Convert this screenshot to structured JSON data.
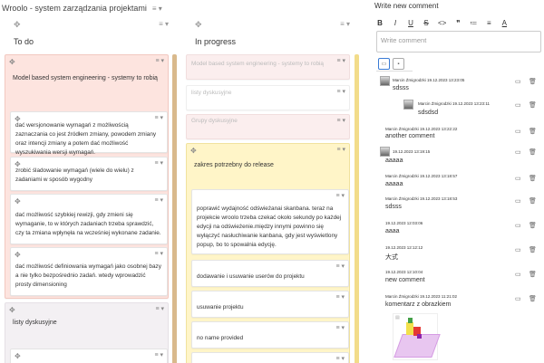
{
  "board": {
    "title": "Wroolo - system zarządzania projektami",
    "title_menu": "≡ ▾",
    "columns": [
      {
        "title": "To do",
        "cards": [
          {
            "text": "Model based system engineering - systemy to robią",
            "style": "pink"
          },
          {
            "text": "dać wersjonowanie wymagań z możliwością zaznaczania co jest źródłem zmiany, powodem zmiany oraz intencji zmiany a potem dać możliwość wyszukiwania wersji wymagań.",
            "style": "inner"
          },
          {
            "text": "zrobić śladowanie wymagań (wiele do wielu) z zadaniami w sposób wygodny",
            "style": "inner"
          },
          {
            "text": "dać możliwość szybkiej rewizji, gdy zmieni się wymaganie, to w których zadaniach trzeba sprawdzić, czy ta zmiana wpłynęła na wcześniej wykonane zadanie.",
            "style": "inner"
          },
          {
            "text": "dać możliwość definiowania wymagań jako osobnej bazy a nie tylko bezpośrednio zadań. wtedy wprowadzić prosty dimensioning",
            "style": "inner"
          },
          {
            "text": "listy dyskusyjne",
            "style": "grey"
          }
        ]
      },
      {
        "title": "In progress",
        "cards": [
          {
            "text": "Model based system engineering - systemy to robią",
            "style": "pinklight"
          },
          {
            "text": "listy dyskusyjne",
            "style": "ghost"
          },
          {
            "text": "Grupy dyskusyjne",
            "style": "pinklight"
          },
          {
            "text": "zakres potrzebny do release",
            "style": "yellow"
          },
          {
            "text": "poprawić wydajność odświeżanai skanbana. teraz na projekcie wroolo trzeba czekać około sekundy po każdej edycji na odświeżenie.między innymi powinno się wyłączyć nasłuchiwanie kanbana, gdy jest wyświetlony popup, bo to spowalnia edycję.",
            "style": "inner"
          },
          {
            "text": "dodawanie i usuwanie userów do projektu",
            "style": "inner"
          },
          {
            "text": "usuwanie projektu",
            "style": "inner"
          },
          {
            "text": "no name provided",
            "style": "inner"
          }
        ]
      }
    ]
  },
  "panel": {
    "title": "Write new comment",
    "toolbar": [
      "B",
      "I",
      "U",
      "S",
      "<>",
      "❞",
      "≔",
      "≡",
      "A"
    ],
    "placeholder": "Write comment",
    "comments": [
      {
        "author": "Marcin Żmigrodzki",
        "date": "19.12.2023 13:23:05",
        "text": "sdsss",
        "avatar": true,
        "indent": 0
      },
      {
        "author": "Marcin Żmigrodzki",
        "date": "19.12.2023 13:23:11",
        "text": "sdsdsd",
        "avatar": true,
        "indent": 1
      },
      {
        "author": "Marcin Żmigrodzki",
        "date": "19.12.2023 13:22:22",
        "text": "another comment",
        "avatar": false,
        "indent": 0
      },
      {
        "author": "",
        "date": "19.12.2023 13:19:15",
        "text": "aaaaa",
        "avatar": true,
        "indent": 0
      },
      {
        "author": "Marcin Żmigrodzki",
        "date": "19.12.2023 13:18:57",
        "text": "aaaaa",
        "avatar": false,
        "indent": 0
      },
      {
        "author": "Marcin Żmigrodzki",
        "date": "19.12.2023 13:18:53",
        "text": "sdsss",
        "avatar": false,
        "indent": 0
      },
      {
        "author": "",
        "date": "19.12.2023 12:03:06",
        "text": "aaaa",
        "avatar": false,
        "indent": 0
      },
      {
        "author": "",
        "date": "19.12.2023 12:12:12",
        "text": "大式",
        "avatar": false,
        "indent": 0
      },
      {
        "author": "",
        "date": "19.12.2023 12:10:04",
        "text": "new comment",
        "avatar": false,
        "indent": 0
      },
      {
        "author": "Marcin Żmigrodzki",
        "date": "19.12.2023 11:21:02",
        "text": "komentarz z obrazkiem",
        "avatar": false,
        "indent": 0
      }
    ]
  }
}
